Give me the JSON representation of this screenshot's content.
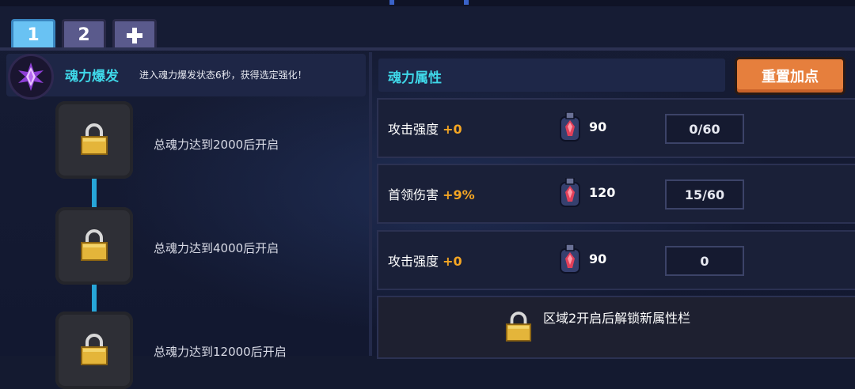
{
  "tabs": [
    {
      "label": "1",
      "active": true
    },
    {
      "label": "2",
      "active": false
    },
    {
      "label": "+",
      "active": false
    }
  ],
  "soul_burst": {
    "title": "魂力爆发",
    "description": "进入魂力爆发状态6秒，获得选定强化！",
    "icon": "purple-crystal-emblem-icon"
  },
  "unlock_nodes": [
    {
      "label": "总魂力达到2000后开启",
      "locked": true
    },
    {
      "label": "总魂力达到4000后开启",
      "locked": true
    },
    {
      "label": "总魂力达到12000后开启",
      "locked": true
    }
  ],
  "attributes": {
    "title": "魂力属性",
    "reset_label": "重置加点",
    "rows": [
      {
        "name": "攻击强度",
        "bonus": "+0",
        "cost": "90",
        "points": "0/60",
        "icon": "red-potion-icon"
      },
      {
        "name": "首领伤害",
        "bonus": "+9%",
        "cost": "120",
        "points": "15/60",
        "icon": "red-potion-icon"
      },
      {
        "name": "攻击强度",
        "bonus": "+0",
        "cost": "90",
        "points": "0",
        "icon": "red-potion-icon"
      }
    ],
    "locked_text": "区域2开启后解锁新属性栏"
  },
  "colors": {
    "accent_cyan": "#3fd7e8",
    "bonus_orange": "#f5a623",
    "reset_button": "#e67f3d",
    "active_tab": "#69c2f3",
    "inactive_tab": "#5a5a8c"
  }
}
